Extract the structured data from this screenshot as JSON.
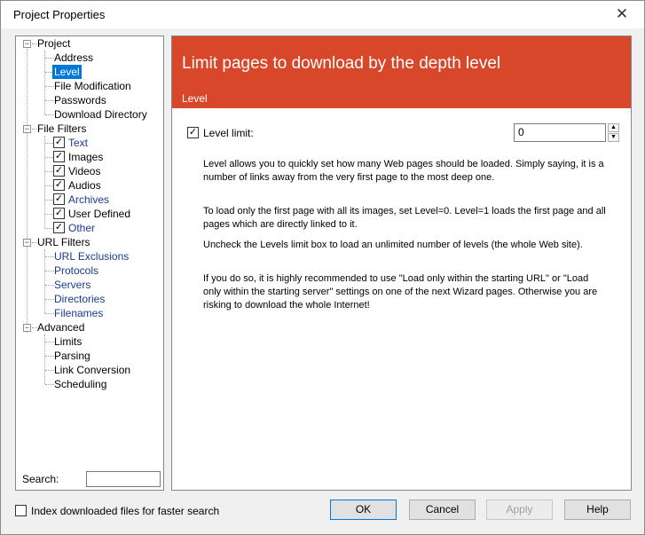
{
  "window": {
    "title": "Project Properties"
  },
  "tree": {
    "project": {
      "label": "Project",
      "children": [
        "Address",
        "Level",
        "File Modification",
        "Passwords",
        "Download Directory"
      ]
    },
    "file_filters": {
      "label": "File Filters",
      "children": [
        "Text",
        "Images",
        "Videos",
        "Audios",
        "Archives",
        "User Defined",
        "Other"
      ]
    },
    "url_filters": {
      "label": "URL Filters",
      "children": [
        "URL Exclusions",
        "Protocols",
        "Servers",
        "Directories",
        "Filenames"
      ]
    },
    "advanced": {
      "label": "Advanced",
      "children": [
        "Limits",
        "Parsing",
        "Link Conversion",
        "Scheduling"
      ]
    },
    "selected": "Level"
  },
  "search": {
    "label": "Search:",
    "value": ""
  },
  "content": {
    "title": "Limit pages to download by the depth level",
    "section": "Level",
    "level_limit_label": "Level limit:",
    "level_limit_checked": true,
    "level_value": "0",
    "paragraphs": [
      "Level allows you to quickly set how many Web pages should be loaded. Simply saying, it is a number of links away from the very first page to the most deep one.",
      "To load only the first page with all its images, set Level=0. Level=1 loads the first page and all pages which are directly linked to it.",
      "Uncheck the Levels limit box to load an unlimited number of levels (the whole Web site).",
      "If you do so, it is highly recommended to use \"Load only within the starting URL\" or \"Load only within the starting server\" settings on one of the next Wizard pages. Otherwise you are risking to download the whole Internet!"
    ]
  },
  "footer": {
    "index_label": "Index downloaded files for faster search",
    "index_checked": false,
    "ok": "OK",
    "cancel": "Cancel",
    "apply": "Apply",
    "help": "Help"
  },
  "colors": {
    "accent": "#d9472b",
    "selection": "#0078d7",
    "link": "#1a3a8f"
  }
}
